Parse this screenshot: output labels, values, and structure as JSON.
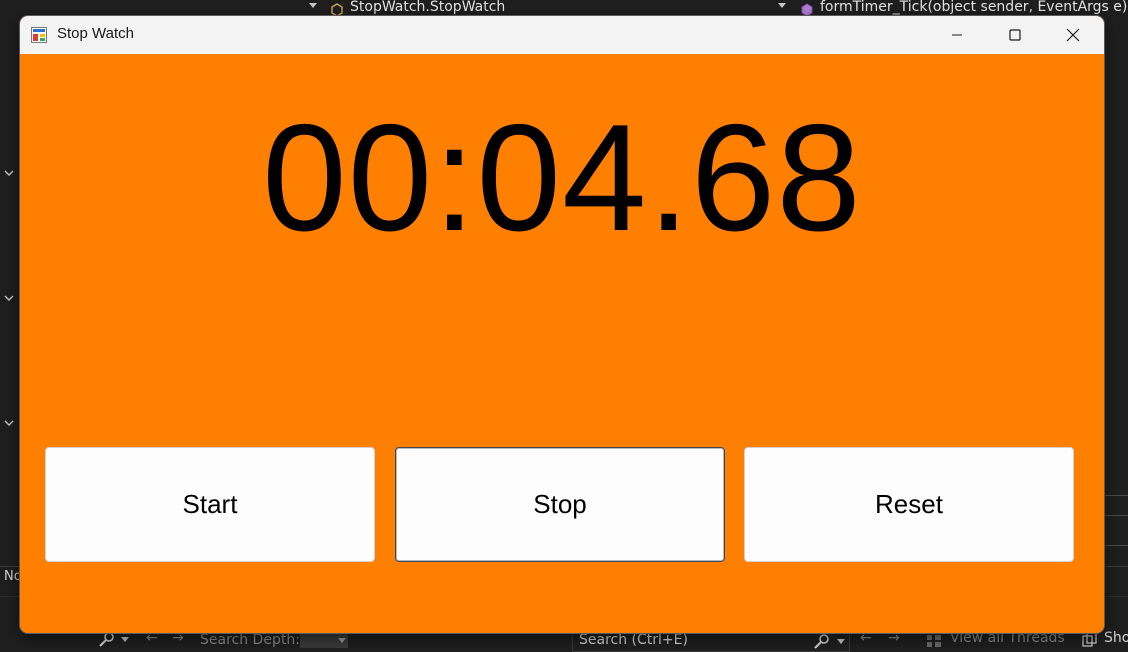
{
  "ide": {
    "class_crumb": "StopWatch.StopWatch",
    "method_crumb": "formTimer_Tick(object sender, EventArgs e)",
    "no_label": "No",
    "search_depth_label": "Search Depth:",
    "search_placeholder": "Search (Ctrl+E)",
    "view_threads_label": "View all Threads",
    "show_label": "Sho"
  },
  "window": {
    "title": "Stop Watch",
    "background_color": "#ff7f00"
  },
  "stopwatch": {
    "time": "00:04.68"
  },
  "buttons": {
    "start_label": "Start",
    "stop_label": "Stop",
    "reset_label": "Reset"
  }
}
